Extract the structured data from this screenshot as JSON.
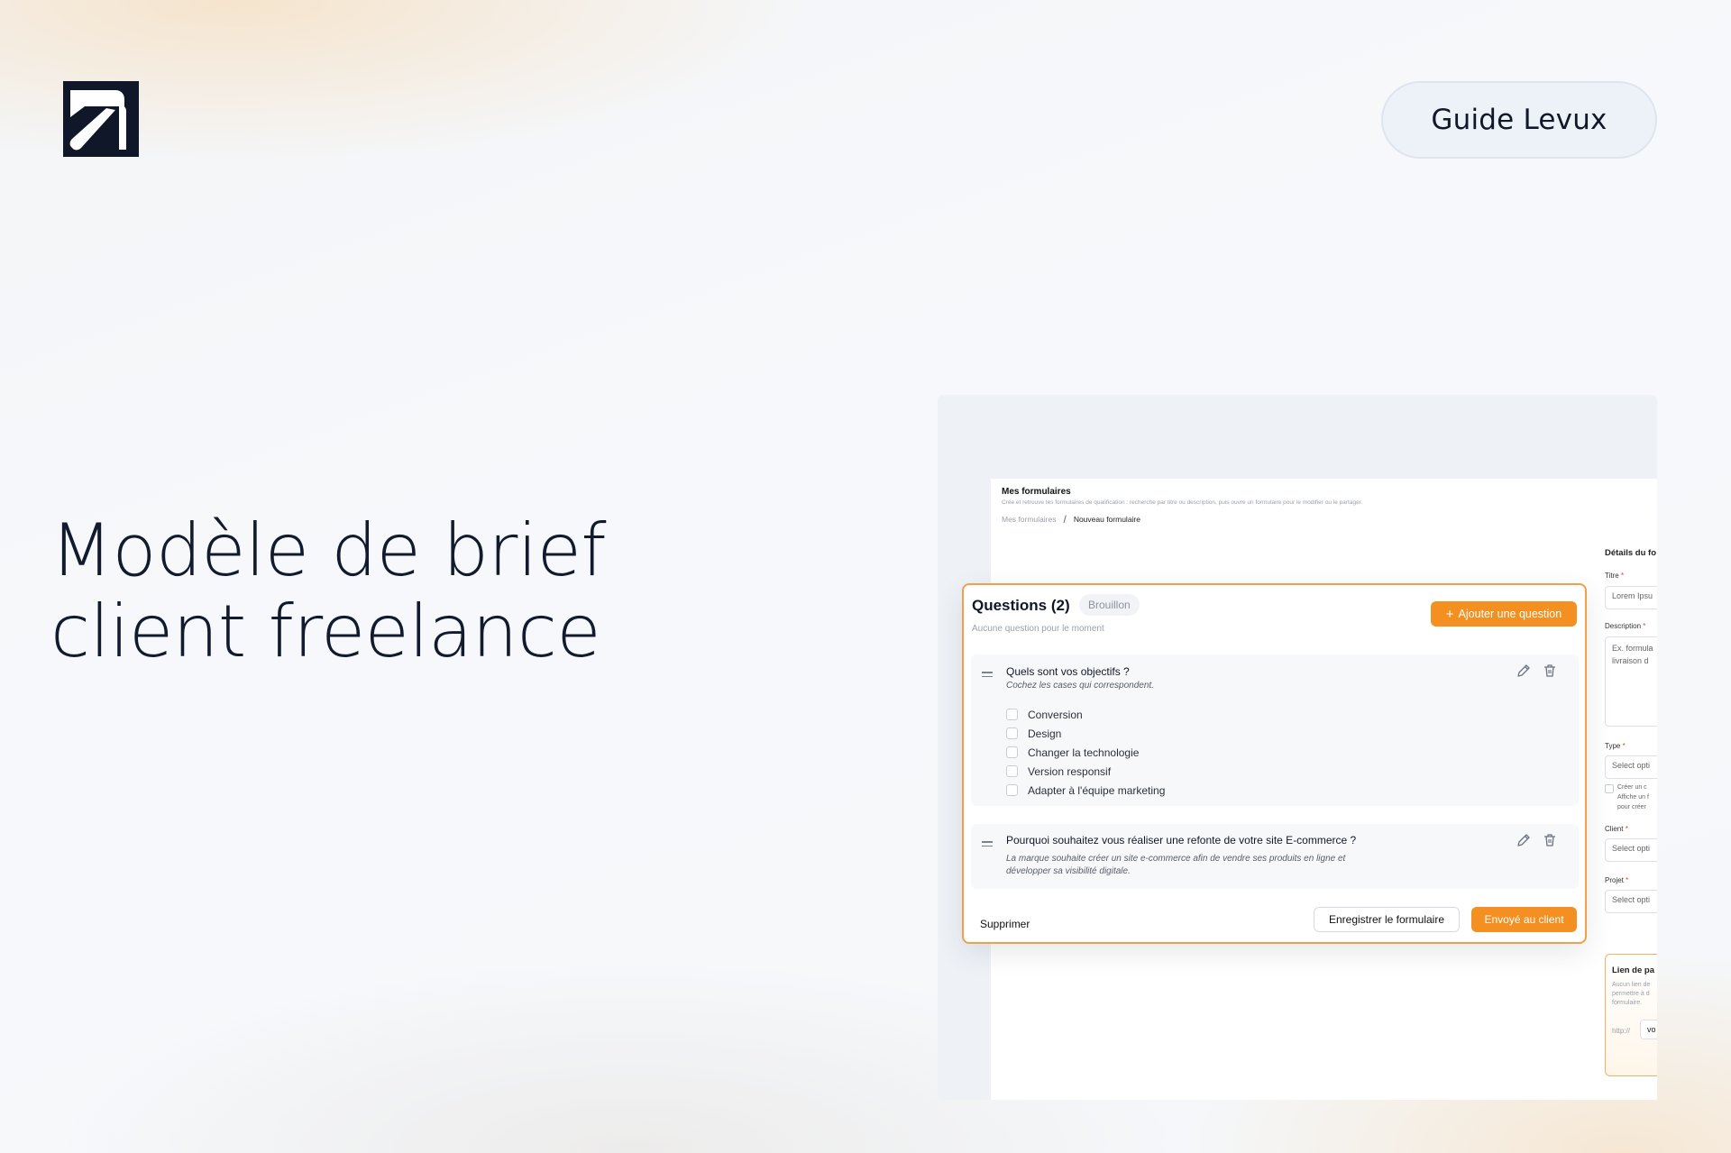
{
  "brand": {
    "logo_icon": "levux-logo-icon"
  },
  "guide_pill": {
    "label": "Guide Levux"
  },
  "headline": {
    "line1": "Modèle de brief",
    "line2": "client freelance"
  },
  "mock_page": {
    "title": "Mes formulaires",
    "subtitle": "Crée et retrouve tes formulaires de qualification : recherche par titre ou description, puis ouvre un formulaire pour le modifier ou le partager.",
    "breadcrumb": {
      "parent": "Mes formulaires",
      "current": "Nouveau formulaire"
    }
  },
  "questions_card": {
    "title": "Questions (2)",
    "status_badge": "Brouillon",
    "empty_text": "Aucune question pour le moment",
    "add_button": "Ajouter une question",
    "questions": [
      {
        "text": "Quels sont vos objectifs ?",
        "hint": "Cochez les cases qui correspondent.",
        "options": [
          "Conversion",
          "Design",
          "Changer la technologie",
          "Version responsif",
          "Adapter à l'équipe marketing"
        ]
      },
      {
        "text": "Pourquoi souhaitez vous réaliser une refonte de votre site E-commerce ?",
        "hint_line1": "La marque souhaite créer un site e-commerce afin de vendre ses produits en ligne et",
        "hint_line2": "développer sa visibilité digitale."
      }
    ],
    "delete_button": "Supprimer",
    "save_button": "Enregistrer le formulaire",
    "send_button": "Envoyé au client"
  },
  "details_panel": {
    "heading": "Détails du fo",
    "title_label": "Titre",
    "title_value": "Lorem Ipsu",
    "description_label": "Description",
    "description_line1": "Ex. formula",
    "description_line2": "livraison d",
    "type_label": "Type",
    "type_value": "Select opti",
    "create_line1": "Créer un c",
    "create_line2": "Affiche un f",
    "create_line3": "pour créer",
    "client_label": "Client",
    "client_value": "Select opti",
    "project_label": "Projet",
    "project_value": "Select opti",
    "link_title": "Lien de pa",
    "link_desc1": "Aucun lien de",
    "link_desc2": "permettre à d",
    "link_desc3": "formulaire.",
    "link_prefix": "http://",
    "link_value": "vo"
  },
  "colors": {
    "accent": "#f39021",
    "navy": "#0f1729",
    "card_border": "#f0a04b"
  }
}
